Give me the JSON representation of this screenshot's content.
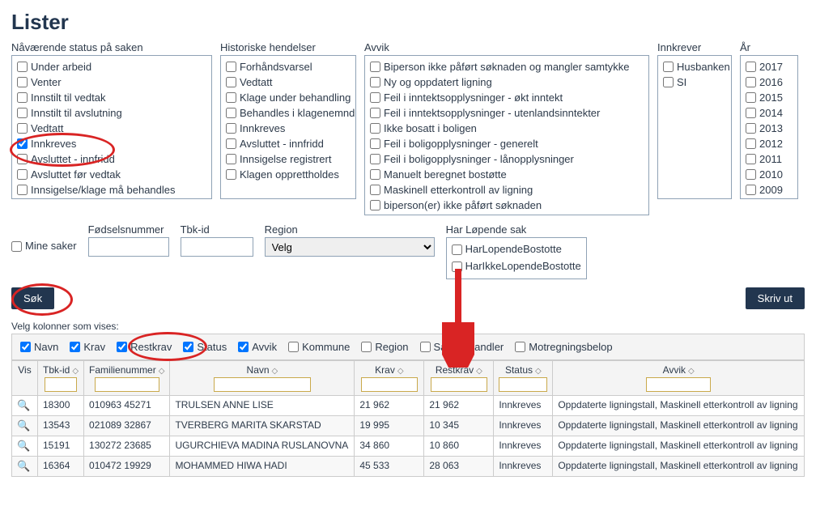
{
  "title": "Lister",
  "filters": {
    "status": {
      "label": "Nåværende status på saken",
      "items": [
        {
          "label": "Under arbeid",
          "checked": false
        },
        {
          "label": "Venter",
          "checked": false
        },
        {
          "label": "Innstilt til vedtak",
          "checked": false
        },
        {
          "label": "Innstilt til avslutning",
          "checked": false
        },
        {
          "label": "Vedtatt",
          "checked": false
        },
        {
          "label": "Innkreves",
          "checked": true
        },
        {
          "label": "Avsluttet - innfridd",
          "checked": false
        },
        {
          "label": "Avsluttet før vedtak",
          "checked": false
        },
        {
          "label": "Innsigelse/klage må behandles",
          "checked": false
        }
      ]
    },
    "hist": {
      "label": "Historiske hendelser",
      "items": [
        {
          "label": "Forhåndsvarsel"
        },
        {
          "label": "Vedtatt"
        },
        {
          "label": "Klage under behandling"
        },
        {
          "label": "Behandles i klagenemnd"
        },
        {
          "label": "Innkreves"
        },
        {
          "label": "Avsluttet - innfridd"
        },
        {
          "label": "Innsigelse registrert"
        },
        {
          "label": "Klagen opprettholdes"
        }
      ]
    },
    "avvik": {
      "label": "Avvik",
      "items": [
        {
          "label": "Biperson ikke påført søknaden og mangler samtykke"
        },
        {
          "label": "Ny og oppdatert ligning"
        },
        {
          "label": "Feil i inntektsopplysninger - økt inntekt"
        },
        {
          "label": "Feil i inntektsopplysninger - utenlandsinntekter"
        },
        {
          "label": "Ikke bosatt i boligen"
        },
        {
          "label": "Feil i boligopplysninger - generelt"
        },
        {
          "label": "Feil i boligopplysninger - lånopplysninger"
        },
        {
          "label": "Manuelt beregnet bostøtte"
        },
        {
          "label": "Maskinell etterkontroll av ligning"
        },
        {
          "label": "biperson(er) ikke påført søknaden"
        }
      ]
    },
    "innkrever": {
      "label": "Innkrever",
      "items": [
        {
          "label": "Husbanken"
        },
        {
          "label": "SI"
        }
      ]
    },
    "aar": {
      "label": "År",
      "items": [
        {
          "label": "2017"
        },
        {
          "label": "2016"
        },
        {
          "label": "2015"
        },
        {
          "label": "2014"
        },
        {
          "label": "2013"
        },
        {
          "label": "2012"
        },
        {
          "label": "2011"
        },
        {
          "label": "2010"
        },
        {
          "label": "2009"
        }
      ]
    }
  },
  "sec2": {
    "mine_saker": "Mine saker",
    "fnr": "Fødselsnummer",
    "tbk": "Tbk-id",
    "region": "Region",
    "region_value": "Velg",
    "lopende_label": "Har Løpende sak",
    "lopende_items": [
      {
        "label": "HarLopendeBostotte"
      },
      {
        "label": "HarIkkeLopendeBostotte"
      }
    ]
  },
  "buttons": {
    "sok": "Søk",
    "skrivut": "Skriv ut"
  },
  "cols_label": "Velg kolonner som vises:",
  "col_picks": [
    {
      "label": "Navn",
      "checked": true
    },
    {
      "label": "Krav",
      "checked": true
    },
    {
      "label": "Restkrav",
      "checked": true
    },
    {
      "label": "Status",
      "checked": true
    },
    {
      "label": "Avvik",
      "checked": true
    },
    {
      "label": "Kommune",
      "checked": false
    },
    {
      "label": "Region",
      "checked": false
    },
    {
      "label": "Saksbehandler",
      "checked": false
    },
    {
      "label": "Motregningsbelop",
      "checked": false
    }
  ],
  "grid": {
    "headers": {
      "vis": "Vis",
      "tbk": "Tbk-id",
      "fam": "Familienummer",
      "navn": "Navn",
      "krav": "Krav",
      "restkrav": "Restkrav",
      "status": "Status",
      "avvik": "Avvik"
    },
    "rows": [
      {
        "tbk": "18300",
        "fam": "010963 45271",
        "navn": "TRULSEN ANNE LISE",
        "krav": "21 962",
        "restkrav": "21 962",
        "status": "Innkreves",
        "avvik": "Oppdaterte ligningstall, Maskinell etterkontroll av ligning"
      },
      {
        "tbk": "13543",
        "fam": "021089 32867",
        "navn": "TVERBERG MARITA SKARSTAD",
        "krav": "19 995",
        "restkrav": "10 345",
        "status": "Innkreves",
        "avvik": "Oppdaterte ligningstall, Maskinell etterkontroll av ligning"
      },
      {
        "tbk": "15191",
        "fam": "130272 23685",
        "navn": "UGURCHIEVA MADINA RUSLANOVNA",
        "krav": "34 860",
        "restkrav": "10 860",
        "status": "Innkreves",
        "avvik": "Oppdaterte ligningstall, Maskinell etterkontroll av ligning"
      },
      {
        "tbk": "16364",
        "fam": "010472 19929",
        "navn": "MOHAMMED HIWA HADI",
        "krav": "45 533",
        "restkrav": "28 063",
        "status": "Innkreves",
        "avvik": "Oppdaterte ligningstall, Maskinell etterkontroll av ligning"
      }
    ]
  }
}
